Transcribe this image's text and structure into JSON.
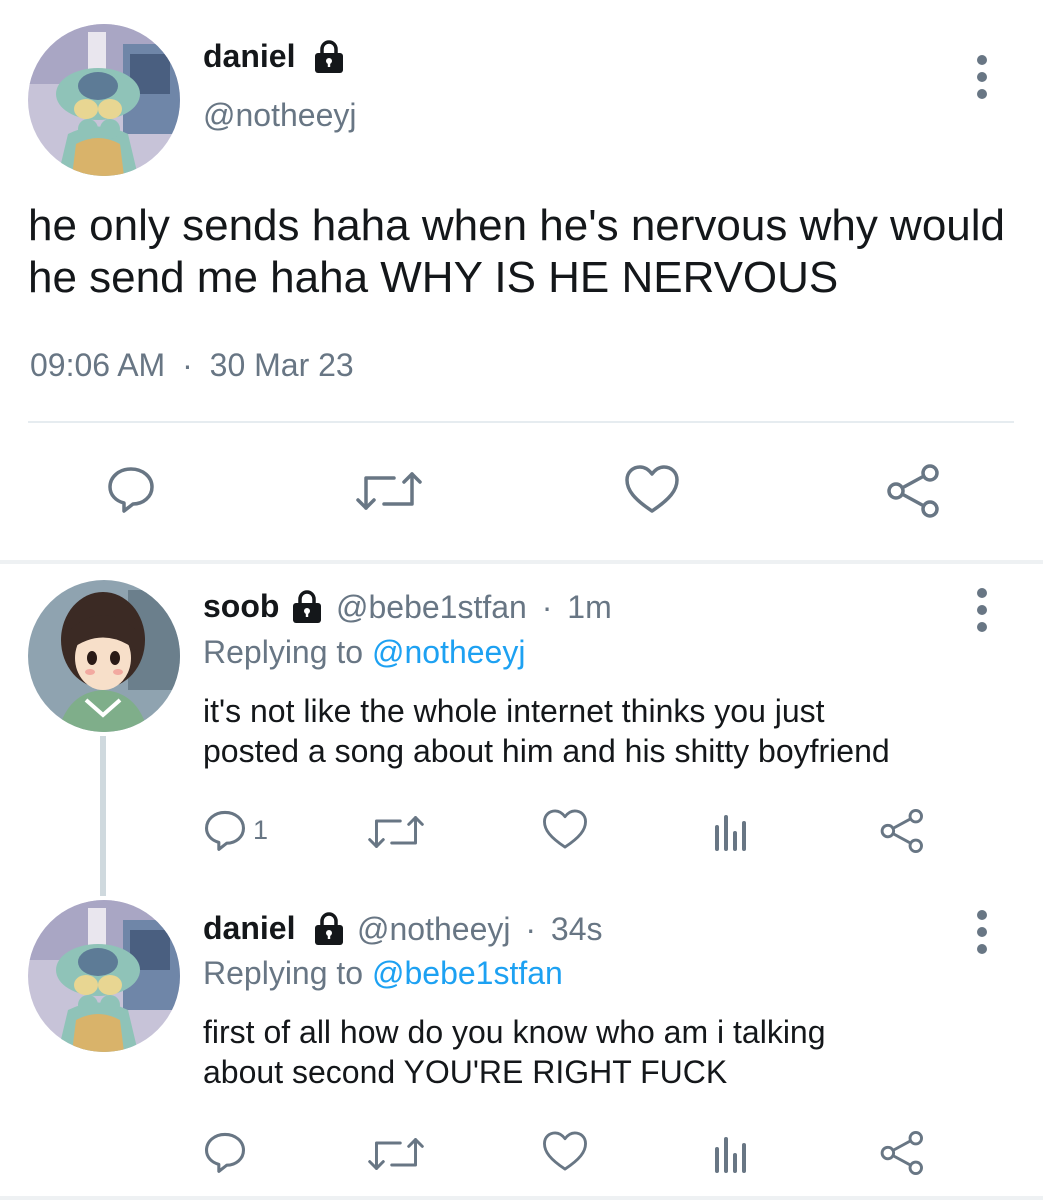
{
  "main_tweet": {
    "display_name": "daniel",
    "handle": "@notheeyj",
    "text_line1": "he only sends haha when he's nervous why would",
    "text_line2": "he send me haha WHY IS HE NERVOUS",
    "time": "09:06 AM",
    "separator": "·",
    "date": "30 Mar 23",
    "actions": [
      "reply-icon",
      "retweet-icon",
      "like-icon",
      "share-icon"
    ]
  },
  "reply1": {
    "display_name": "soob",
    "handle": "@bebe1stfan",
    "separator": "·",
    "age": "1m",
    "replying_prefix": "Replying to",
    "replying_to": "@notheeyj",
    "text_line1": "it's not like the whole internet thinks you just",
    "text_line2": "posted a song about him and his shitty boyfriend",
    "reply_count": "1",
    "actions": [
      "reply-icon",
      "retweet-icon",
      "like-icon",
      "analytics-icon",
      "share-icon"
    ]
  },
  "reply2": {
    "display_name": "daniel",
    "handle": "@notheeyj",
    "separator": "·",
    "age": "34s",
    "replying_prefix": "Replying to",
    "replying_to": "@bebe1stfan",
    "text_line1": "first of all how do you know who am i talking",
    "text_line2": "about second YOU'RE RIGHT FUCK",
    "actions": [
      "reply-icon",
      "retweet-icon",
      "like-icon",
      "analytics-icon",
      "share-icon"
    ]
  },
  "colors": {
    "text": "#14171a",
    "secondary": "#687684",
    "link": "#1da1f2",
    "divider": "#e6ecf0"
  }
}
